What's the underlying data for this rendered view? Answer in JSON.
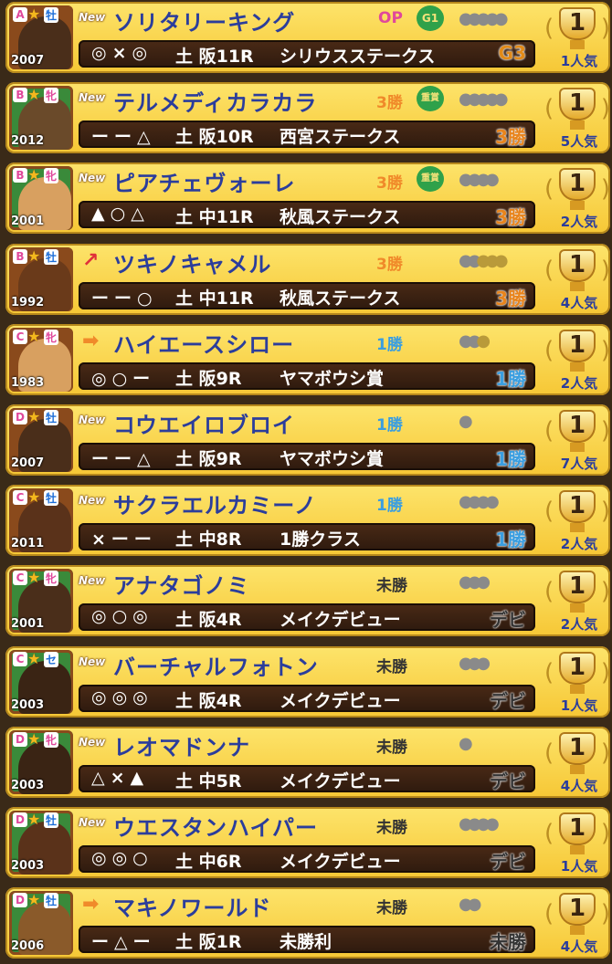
{
  "colors": {
    "grade_op": "#e0489b",
    "grade_3wins": "#f08a2a",
    "grade_1win": "#3a9ee0",
    "grade_maiden": "#333333",
    "name": "#2b3d9c"
  },
  "horses": [
    {
      "rank": "A",
      "sex": "牡",
      "sex_color": "#1b6dd8",
      "year": "2007",
      "coat": "#4a2e1a",
      "portrait_border": "#8a4a1c",
      "new": "New",
      "trend": "",
      "name": "ソリタリーキング",
      "grade": "OP",
      "grade_color": "#e0489b",
      "grade_badge": "G1",
      "badge": "",
      "shoes": "●●●●●",
      "shoes_gold": "",
      "marks": "◎×◎",
      "date": "土 阪11R",
      "race": "シリウスステークス",
      "cls": "G3",
      "cls_color": "#e28a18",
      "place": "1",
      "popularity": "1人気"
    },
    {
      "rank": "B",
      "sex": "牝",
      "sex_color": "#e0489b",
      "year": "2012",
      "coat": "#6a4a2a",
      "portrait_border": "#3a8a3a",
      "new": "New",
      "trend": "",
      "name": "テルメディカラカラ",
      "grade": "3勝",
      "grade_color": "#f08a2a",
      "grade_badge": "",
      "badge": "重賞",
      "shoes": "●●●●●",
      "shoes_gold": "",
      "marks": "ーー△",
      "date": "土 阪10R",
      "race": "西宮ステークス",
      "cls": "3勝",
      "cls_color": "#e8841c",
      "place": "1",
      "popularity": "5人気"
    },
    {
      "rank": "B",
      "sex": "牝",
      "sex_color": "#e0489b",
      "year": "2001",
      "coat": "#d8a060",
      "portrait_border": "#3a8a3a",
      "new": "New",
      "trend": "",
      "name": "ピアチェヴォーレ",
      "grade": "3勝",
      "grade_color": "#f08a2a",
      "grade_badge": "",
      "badge": "重賞",
      "shoes": "●●●●",
      "shoes_gold": "",
      "marks": "▲○△",
      "date": "土 中11R",
      "race": "秋風ステークス",
      "cls": "3勝",
      "cls_color": "#e8841c",
      "place": "1",
      "popularity": "2人気"
    },
    {
      "rank": "B",
      "sex": "牡",
      "sex_color": "#1b6dd8",
      "year": "1992",
      "coat": "#6a3a1a",
      "portrait_border": "#8a4a1c",
      "new": "",
      "trend": "↗",
      "trend_color": "#e0303a",
      "name": "ツキノキャメル",
      "grade": "3勝",
      "grade_color": "#f08a2a",
      "grade_badge": "",
      "badge": "",
      "shoes": "●●",
      "shoes_gold": "●●●",
      "marks": "ーー○",
      "date": "土 中11R",
      "race": "秋風ステークス",
      "cls": "3勝",
      "cls_color": "#e8841c",
      "place": "1",
      "popularity": "4人気"
    },
    {
      "rank": "C",
      "sex": "牝",
      "sex_color": "#e0489b",
      "year": "1983",
      "coat": "#d8a060",
      "portrait_border": "#8a4a1c",
      "new": "",
      "trend": "➡",
      "trend_color": "#f08a2a",
      "name": "ハイエースシロー",
      "grade": "1勝",
      "grade_color": "#3a9ee0",
      "grade_badge": "",
      "badge": "",
      "shoes": "●●",
      "shoes_gold": "●",
      "marks": "◎○ー",
      "date": "土 阪9R",
      "race": "ヤマボウシ賞",
      "cls": "1勝",
      "cls_color": "#3a9ee0",
      "place": "1",
      "popularity": "2人気"
    },
    {
      "rank": "D",
      "sex": "牡",
      "sex_color": "#1b6dd8",
      "year": "2007",
      "coat": "#4a2e1a",
      "portrait_border": "#8a4a1c",
      "new": "New",
      "trend": "",
      "name": "コウエイロブロイ",
      "grade": "1勝",
      "grade_color": "#3a9ee0",
      "grade_badge": "",
      "badge": "",
      "shoes": "●",
      "shoes_gold": "",
      "marks": "ーー△",
      "date": "土 阪9R",
      "race": "ヤマボウシ賞",
      "cls": "1勝",
      "cls_color": "#3a9ee0",
      "place": "1",
      "popularity": "7人気"
    },
    {
      "rank": "C",
      "sex": "牡",
      "sex_color": "#1b6dd8",
      "year": "2011",
      "coat": "#5a321a",
      "portrait_border": "#8a4a1c",
      "new": "New",
      "trend": "",
      "name": "サクラエルカミーノ",
      "grade": "1勝",
      "grade_color": "#3a9ee0",
      "grade_badge": "",
      "badge": "",
      "shoes": "●●●●",
      "shoes_gold": "",
      "marks": "×ーー",
      "date": "土 中8R",
      "race": "1勝クラス",
      "cls": "1勝",
      "cls_color": "#3a9ee0",
      "place": "1",
      "popularity": "2人気"
    },
    {
      "rank": "C",
      "sex": "牝",
      "sex_color": "#e0489b",
      "year": "2001",
      "coat": "#4a2e1a",
      "portrait_border": "#3a8a3a",
      "new": "New",
      "trend": "",
      "name": "アナタゴノミ",
      "grade": "未勝",
      "grade_color": "#333333",
      "grade_badge": "",
      "badge": "",
      "shoes": "●●●",
      "shoes_gold": "",
      "marks": "◎○◎",
      "date": "土 阪4R",
      "race": "メイクデビュー",
      "cls": "デビ",
      "cls_color": "#333333",
      "place": "1",
      "popularity": "2人気"
    },
    {
      "rank": "C",
      "sex": "セ",
      "sex_color": "#1b6dd8",
      "year": "2003",
      "coat": "#3a2414",
      "portrait_border": "#3a8a3a",
      "new": "New",
      "trend": "",
      "name": "バーチャルフォトン",
      "grade": "未勝",
      "grade_color": "#333333",
      "grade_badge": "",
      "badge": "",
      "shoes": "●●●",
      "shoes_gold": "",
      "marks": "◎◎◎",
      "date": "土 阪4R",
      "race": "メイクデビュー",
      "cls": "デビ",
      "cls_color": "#333333",
      "place": "1",
      "popularity": "1人気"
    },
    {
      "rank": "D",
      "sex": "牝",
      "sex_color": "#e0489b",
      "year": "2003",
      "coat": "#3a2414",
      "portrait_border": "#3a8a3a",
      "new": "New",
      "trend": "",
      "name": "レオマドンナ",
      "grade": "未勝",
      "grade_color": "#333333",
      "grade_badge": "",
      "badge": "",
      "shoes": "●",
      "shoes_gold": "",
      "marks": "△×▲",
      "date": "土 中5R",
      "race": "メイクデビュー",
      "cls": "デビ",
      "cls_color": "#333333",
      "place": "1",
      "popularity": "4人気"
    },
    {
      "rank": "D",
      "sex": "牡",
      "sex_color": "#1b6dd8",
      "year": "2003",
      "coat": "#5a321a",
      "portrait_border": "#3a8a3a",
      "new": "New",
      "trend": "",
      "name": "ウエスタンハイパー",
      "grade": "未勝",
      "grade_color": "#333333",
      "grade_badge": "",
      "badge": "",
      "shoes": "●●●●",
      "shoes_gold": "",
      "marks": "◎◎○",
      "date": "土 中6R",
      "race": "メイクデビュー",
      "cls": "デビ",
      "cls_color": "#333333",
      "place": "1",
      "popularity": "1人気"
    },
    {
      "rank": "D",
      "sex": "牡",
      "sex_color": "#1b6dd8",
      "year": "2006",
      "coat": "#8a5a2a",
      "portrait_border": "#3a8a3a",
      "new": "",
      "trend": "➡",
      "trend_color": "#f08a2a",
      "name": "マキノワールド",
      "grade": "未勝",
      "grade_color": "#333333",
      "grade_badge": "",
      "badge": "",
      "shoes": "●●",
      "shoes_gold": "",
      "marks": "ー△ー",
      "date": "土 阪1R",
      "race": "未勝利",
      "cls": "未勝",
      "cls_color": "#333333",
      "place": "1",
      "popularity": "4人気"
    }
  ]
}
